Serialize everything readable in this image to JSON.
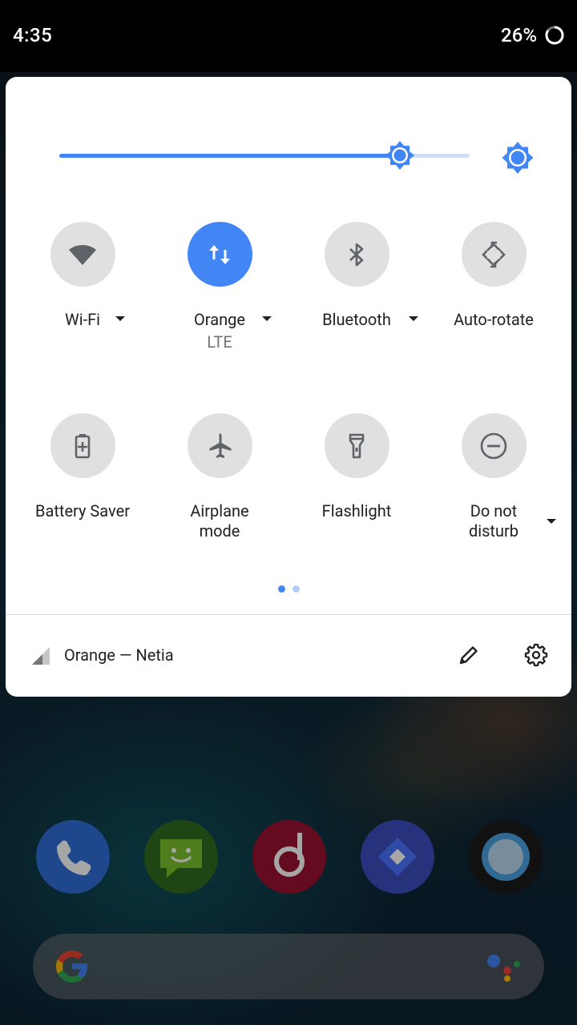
{
  "status_bar": {
    "time": "4:35",
    "battery_percent": "26%"
  },
  "brightness": {
    "level": 0.83
  },
  "tiles": [
    {
      "id": "wifi",
      "label": "Wi-Fi",
      "sublabel": "",
      "icon": "wifi-icon",
      "active": false,
      "has_dropdown": true
    },
    {
      "id": "mobile-data",
      "label": "Orange",
      "sublabel": "LTE",
      "icon": "mobile-data-icon",
      "active": true,
      "has_dropdown": true
    },
    {
      "id": "bluetooth",
      "label": "Bluetooth",
      "sublabel": "",
      "icon": "bluetooth-icon",
      "active": false,
      "has_dropdown": true
    },
    {
      "id": "auto-rotate",
      "label": "Auto-rotate",
      "sublabel": "",
      "icon": "auto-rotate-icon",
      "active": false,
      "has_dropdown": false
    },
    {
      "id": "battery-saver",
      "label": "Battery Saver",
      "sublabel": "",
      "icon": "battery-saver-icon",
      "active": false,
      "has_dropdown": false
    },
    {
      "id": "airplane-mode",
      "label": "Airplane\nmode",
      "sublabel": "",
      "icon": "airplane-icon",
      "active": false,
      "has_dropdown": false
    },
    {
      "id": "flashlight",
      "label": "Flashlight",
      "sublabel": "",
      "icon": "flashlight-icon",
      "active": false,
      "has_dropdown": false
    },
    {
      "id": "do-not-disturb",
      "label": "Do not\ndisturb",
      "sublabel": "",
      "icon": "do-not-disturb-icon",
      "active": false,
      "has_dropdown": true
    }
  ],
  "pager": {
    "pages": 2,
    "current": 1
  },
  "footer": {
    "carrier": "Orange — Netia"
  },
  "colors": {
    "accent": "#4285f4",
    "tile_inactive": "#e0e0e0",
    "icon_inactive": "#5f6368",
    "panel": "#ffffff"
  },
  "dock": [
    {
      "name": "phone-app-icon"
    },
    {
      "name": "messenger-app-icon"
    },
    {
      "name": "music-app-icon"
    },
    {
      "name": "maps-app-icon"
    },
    {
      "name": "camera-app-icon"
    }
  ]
}
